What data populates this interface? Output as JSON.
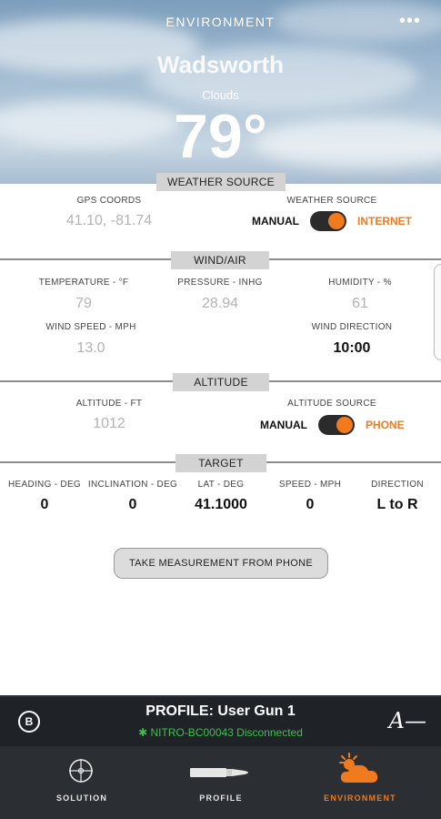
{
  "header": {
    "title": "ENVIRONMENT",
    "menu_icon": "more-dots-icon",
    "location": "Wadsworth",
    "condition": "Clouds",
    "temperature": "79°"
  },
  "weather_source": {
    "section_title": "WEATHER SOURCE",
    "gps_label": "GPS COORDS",
    "gps_value": "41.10, -81.74",
    "source_label": "WEATHER SOURCE",
    "toggle_left": "MANUAL",
    "toggle_right": "INTERNET",
    "toggle_on": true
  },
  "wind_air": {
    "section_title": "WIND/AIR",
    "temperature_label": "TEMPERATURE - °F",
    "temperature_value": "79",
    "pressure_label": "PRESSURE - INHG",
    "pressure_value": "28.94",
    "humidity_label": "HUMIDITY - %",
    "humidity_value": "61",
    "wind_speed_label": "WIND SPEED - MPH",
    "wind_speed_value": "13.0",
    "wind_direction_label": "WIND DIRECTION",
    "wind_direction_value": "10:00"
  },
  "altitude": {
    "section_title": "ALTITUDE",
    "altitude_label": "ALTITUDE - FT",
    "altitude_value": "1012",
    "source_label": "ALTITUDE SOURCE",
    "toggle_left": "MANUAL",
    "toggle_right": "PHONE",
    "toggle_on": true
  },
  "target": {
    "section_title": "TARGET",
    "columns": [
      {
        "label": "HEADING - DEG",
        "value": "0"
      },
      {
        "label": "INCLINATION - DEG",
        "value": "0"
      },
      {
        "label": "LAT - DEG",
        "value": "41.1000"
      },
      {
        "label": "SPEED - MPH",
        "value": "0"
      },
      {
        "label": "DIRECTION",
        "value": "L to R"
      }
    ]
  },
  "measure_button": "TAKE MEASUREMENT FROM PHONE",
  "profile_bar": {
    "title": "PROFILE: User Gun 1",
    "status": "NITRO-BC00043 Disconnected",
    "bluetooth_icon": "bluetooth-icon",
    "status_color": "#3fbf4e"
  },
  "tabs": [
    {
      "label": "SOLUTION",
      "icon": "crosshair-icon",
      "active": false
    },
    {
      "label": "PROFILE",
      "icon": "cartridge-icon",
      "active": false
    },
    {
      "label": "ENVIRONMENT",
      "icon": "sun-cloud-icon",
      "active": true
    }
  ],
  "colors": {
    "accent": "#f07a1e",
    "bar_dark": "#1f2226",
    "tab_bar": "#2b2e32"
  }
}
